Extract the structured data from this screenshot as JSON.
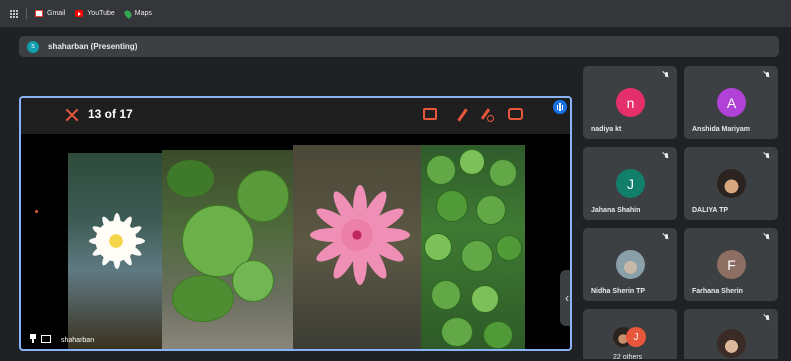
{
  "bookmarks": [
    {
      "label": "Gmail",
      "icon": "gmail-icon"
    },
    {
      "label": "YouTube",
      "icon": "youtube-icon"
    },
    {
      "label": "Maps",
      "icon": "maps-icon"
    }
  ],
  "presenting": {
    "avatar_letter": "s",
    "label": "shaharban (Presenting)"
  },
  "stage": {
    "counter": "13 of 17",
    "presenter_name": "shaharban",
    "accent_color": "#e8563c",
    "border_color": "#8ab4f8"
  },
  "participants": [
    {
      "name": "nadiya kt",
      "initial": "n",
      "color": "#e52f6a"
    },
    {
      "name": "Anshida Mariyam",
      "initial": "A",
      "color": "#b142d8"
    },
    {
      "name": "Jahana Shahin",
      "initial": "J",
      "color": "#127f6b"
    },
    {
      "name": "DALIYA TP",
      "initial": "",
      "color": ""
    },
    {
      "name": "Nidha Sherin TP",
      "initial": "",
      "color": ""
    },
    {
      "name": "Farhana Sherin",
      "initial": "F",
      "color": "#8d6e63"
    },
    {
      "name": "22 others",
      "initial": "J",
      "color": "#e8563c"
    },
    {
      "name": "",
      "initial": "",
      "color": ""
    }
  ]
}
